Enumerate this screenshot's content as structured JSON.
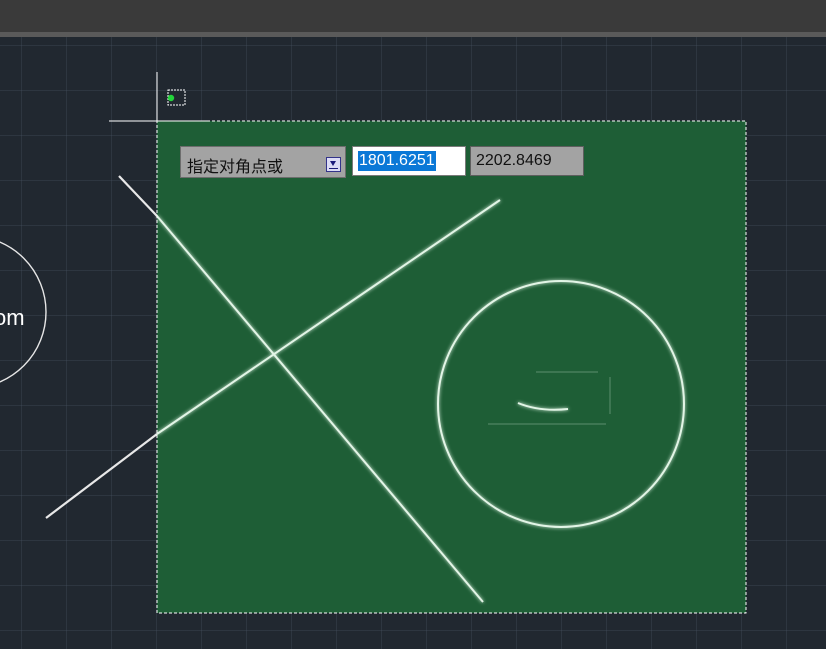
{
  "toolbar": {
    "label": ""
  },
  "drawing": {
    "left_circle_text": "om",
    "selection_fill": "#1e5e36",
    "line_color": "#e8f4ea",
    "grid_color": "#3a4452",
    "background": "#212830"
  },
  "command_prompt": {
    "label": "指定对角点或",
    "options_icon": "dropdown-arrow-icon",
    "x_value": "1801.6251",
    "y_value": "2202.8469"
  }
}
